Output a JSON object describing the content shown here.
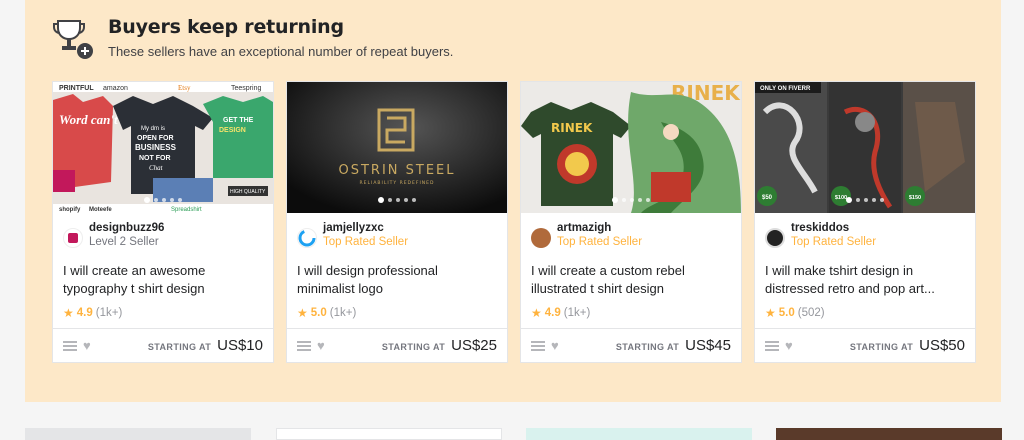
{
  "section": {
    "title": "Buyers keep returning",
    "subtitle": "These sellers have an exceptional number of repeat buyers.",
    "icon": "trophy-icon"
  },
  "gigs": [
    {
      "seller": "designbuzz96",
      "level": "Level 2 Seller",
      "title": "I will create an awesome typography t shirt design",
      "rating": "4.9",
      "reviews": "(1k+)",
      "price_label": "STARTING AT",
      "price": "US$10",
      "thumb_text": [
        "PRINTFUL",
        "amazon",
        "Etsy",
        "Teespring",
        "Word can't",
        "My dm is OPEN FOR BUSINESS NOT FOR Chat",
        "GET THE DESIGN",
        "shopify",
        "Moteefe",
        "Spreadshirt",
        "HIGH QUALITY"
      ]
    },
    {
      "seller": "jamjellyzxc",
      "level": "Top Rated Seller",
      "title": "I will design professional minimalist logo",
      "rating": "5.0",
      "reviews": "(1k+)",
      "price_label": "STARTING AT",
      "price": "US$25",
      "thumb_text": [
        "OSTRIN STEEL",
        "RELIABILITY REDEFINED"
      ]
    },
    {
      "seller": "artmazigh",
      "level": "Top Rated Seller",
      "title": "I will create a custom rebel illustrated t shirt design",
      "rating": "4.9",
      "reviews": "(1k+)",
      "price_label": "STARTING AT",
      "price": "US$45",
      "thumb_text": [
        "RINEK",
        "RINEK"
      ]
    },
    {
      "seller": "treskiddos",
      "level": "Top Rated Seller",
      "title": "I will make tshirt design in distressed retro and pop art...",
      "rating": "5.0",
      "reviews": "(502)",
      "price_label": "STARTING AT",
      "price": "US$50",
      "thumb_text": [
        "ONLY ON FIVERR",
        "$50",
        "$100",
        "$150"
      ]
    }
  ],
  "colors": {
    "section_bg": "#fde8c8",
    "accent": "#ffb33e",
    "text": "#222325"
  }
}
